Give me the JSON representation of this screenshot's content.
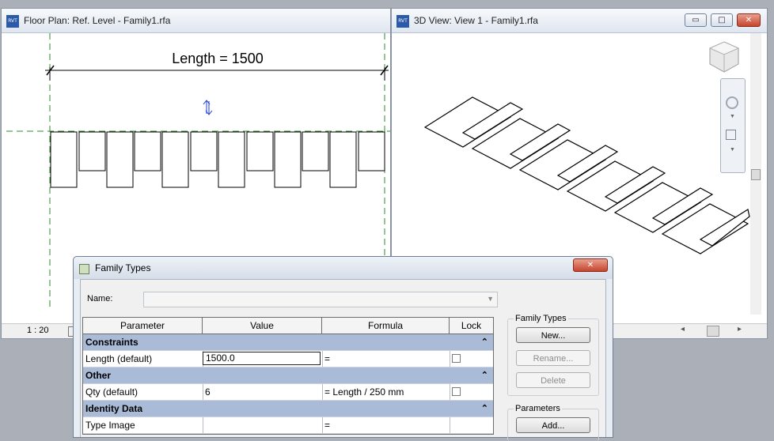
{
  "floor_plan": {
    "app_icon": "RVT",
    "title": "Floor Plan: Ref. Level - Family1.rfa",
    "dimension_label": "Length = 1500",
    "scale": "1 : 20",
    "flip_icon": "flip-arrows-icon"
  },
  "view_3d": {
    "app_icon": "RVT",
    "title": "3D View: View 1 - Family1.rfa",
    "min_symbol": "▭",
    "max_symbol": "□",
    "close_symbol": "✕",
    "nav_icons": [
      "viewcube-icon",
      "steering-wheel-icon",
      "zoom-region-icon"
    ]
  },
  "dialog": {
    "title": "Family Types",
    "close_symbol": "✕",
    "name_label": "Name:",
    "name_value": "",
    "columns": [
      "Parameter",
      "Value",
      "Formula",
      "Lock"
    ],
    "groups": [
      {
        "label": "Constraints",
        "rows": [
          {
            "param": "Length (default)",
            "value": "1500.0",
            "formula": "="
          }
        ]
      },
      {
        "label": "Other",
        "rows": [
          {
            "param": "Qty (default)",
            "value": "6",
            "formula": "= Length / 250 mm"
          }
        ]
      },
      {
        "label": "Identity Data",
        "rows": [
          {
            "param": "Type Image",
            "value": "",
            "formula": "="
          }
        ]
      }
    ],
    "family_types_label": "Family Types",
    "new_button": "New...",
    "rename_button": "Rename...",
    "delete_button": "Delete",
    "parameters_label": "Parameters",
    "add_button": "Add..."
  }
}
